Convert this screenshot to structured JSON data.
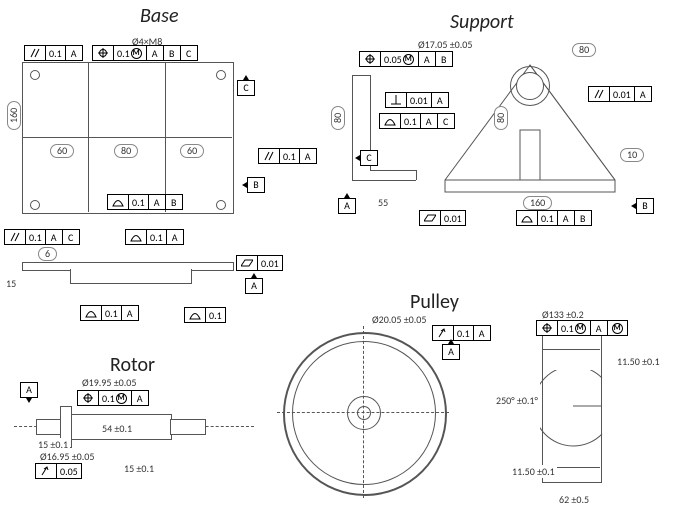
{
  "titles": {
    "base": "Base",
    "support": "Support",
    "pulley": "Pulley",
    "rotor": "Rotor"
  },
  "base": {
    "dims": {
      "height": "160",
      "w_left": "60",
      "w_mid": "80",
      "w_right": "60",
      "holes": "Ø4×M8",
      "side_6": "6",
      "side_15": "15"
    },
    "fcf": {
      "par1": {
        "tol": "0.1",
        "refs": [
          "A"
        ]
      },
      "pos1": {
        "tol": "0.1",
        "mmc": true,
        "refs": [
          "A",
          "B",
          "C"
        ]
      },
      "par_r": {
        "tol": "0.1",
        "refs": [
          "A"
        ]
      },
      "prof": {
        "tol": "0.1",
        "refs": [
          "A",
          "B"
        ]
      },
      "par_bl": {
        "tol": "0.1",
        "refs": [
          "A",
          "C"
        ]
      },
      "prof2": {
        "tol": "0.1",
        "refs": [
          "A"
        ]
      },
      "flat_br": {
        "tol": "0.01"
      },
      "prof_bot": {
        "tol": "0.1",
        "refs": [
          "A"
        ]
      },
      "prof_bot2": {
        "tol": "0.1",
        "refs": []
      }
    },
    "datums": {
      "a": "A",
      "b": "B",
      "c": "C"
    }
  },
  "support": {
    "dims": {
      "hole": "Ø17.05 ±0.05",
      "w_top": "80",
      "h": "80",
      "h2": "80",
      "w_bot": "160",
      "w10": "10",
      "left": "55"
    },
    "fcf": {
      "pos": {
        "tol": "0.05",
        "mmc": true,
        "refs": [
          "A",
          "B"
        ]
      },
      "perp": {
        "tol": "0.01",
        "refs": [
          "A"
        ]
      },
      "par_tr": {
        "tol": "0.01",
        "refs": [
          "A"
        ]
      },
      "par_l": {
        "tol": "0.1",
        "refs": [
          "A",
          "C"
        ]
      },
      "flat_l": {
        "tol": "0.01"
      },
      "prof_br": {
        "tol": "0.1",
        "refs": [
          "A",
          "B"
        ]
      }
    },
    "datums": {
      "a": "A",
      "b": "B",
      "c": "C"
    }
  },
  "pulley": {
    "dims": {
      "bore": "Ø20.05 ±0.05",
      "outer": "Ø133 ±0.2",
      "angle": "250° ±0.1°",
      "h_top": "11.50 ±0.1",
      "h_bot": "11.50 ±0.1",
      "width": "62 ±0.5"
    },
    "fcf": {
      "run": {
        "tol": "0.1",
        "refs": [
          "A"
        ]
      },
      "pos": {
        "tol": "0.1",
        "mmc": true,
        "refs": [
          "A",
          "M"
        ]
      }
    },
    "datums": {
      "a": "A"
    }
  },
  "rotor": {
    "dims": {
      "d1": "Ø19.95 ±0.05",
      "d2": "Ø16.95 ±0.05",
      "l1": "54 ±0.1",
      "l2": "15 ±0.1",
      "l3": "15 ±0.1"
    },
    "fcf": {
      "pos": {
        "tol": "0.1",
        "mmc": true,
        "refs": [
          "A"
        ]
      },
      "run": {
        "tol": "0.05"
      }
    },
    "datums": {
      "a": "A"
    }
  }
}
